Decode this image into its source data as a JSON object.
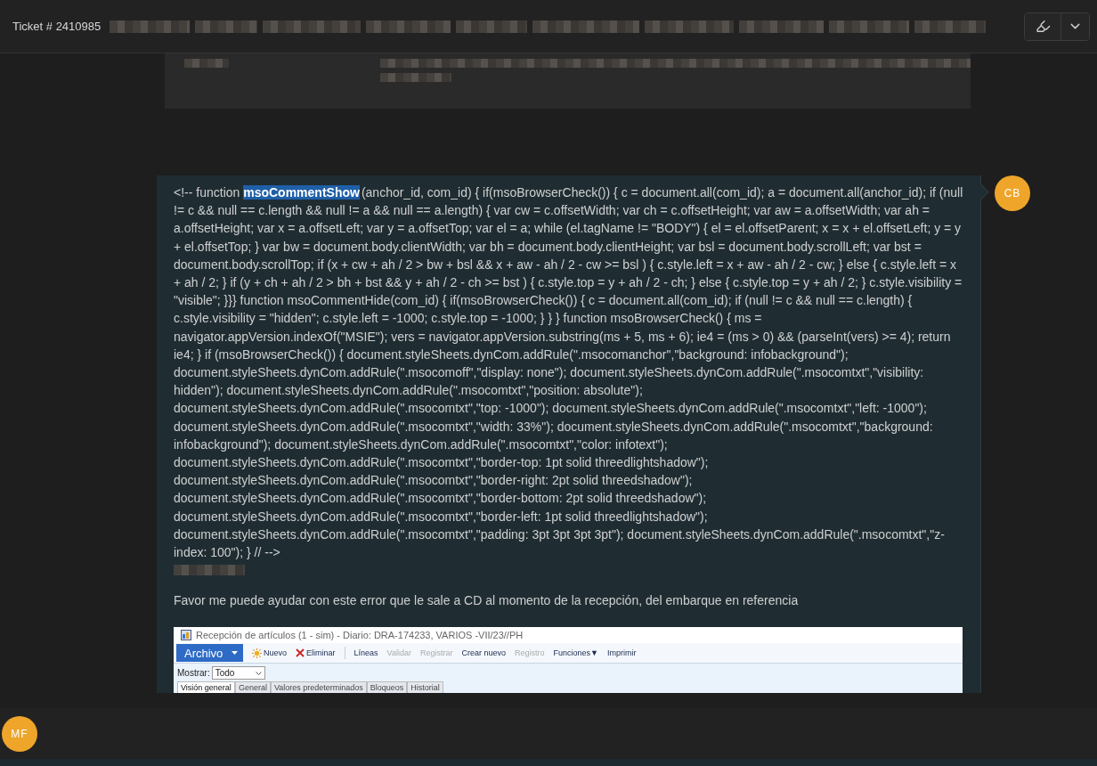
{
  "header": {
    "ticket": "Ticket # 2410985",
    "actions": [
      {
        "kind": "highlighter"
      },
      {
        "kind": "chevron"
      }
    ]
  },
  "message": {
    "avatar": "CB",
    "code": {
      "before": "<!-- function ",
      "highlighted": "msoCommentShow",
      "after": "(anchor_id, com_id) { if(msoBrowserCheck()) { c = document.all(com_id); a = document.all(anchor_id); if (null != c && null == c.length && null != a && null == a.length) { var cw = c.offsetWidth; var ch = c.offsetHeight; var aw = a.offsetWidth; var ah = a.offsetHeight; var x = a.offsetLeft; var y = a.offsetTop; var el = a; while (el.tagName != \"BODY\") { el = el.offsetParent; x = x + el.offsetLeft; y = y + el.offsetTop; } var bw = document.body.clientWidth; var bh = document.body.clientHeight; var bsl = document.body.scrollLeft; var bst = document.body.scrollTop; if (x + cw + ah / 2 > bw + bsl && x + aw - ah / 2 - cw >= bsl ) { c.style.left = x + aw - ah / 2 - cw; } else { c.style.left = x + ah / 2; } if (y + ch + ah / 2 > bh + bst && y + ah / 2 - ch >= bst ) { c.style.top = y + ah / 2 - ch; } else { c.style.top = y + ah / 2; } c.style.visibility = \"visible\"; }}} function msoCommentHide(com_id) { if(msoBrowserCheck()) { c = document.all(com_id); if (null != c && null == c.length) { c.style.visibility = \"hidden\"; c.style.left = -1000; c.style.top = -1000; } } } function msoBrowserCheck() { ms = navigator.appVersion.indexOf(\"MSIE\"); vers = navigator.appVersion.substring(ms + 5, ms + 6); ie4 = (ms > 0) && (parseInt(vers) >= 4); return ie4; } if (msoBrowserCheck()) { document.styleSheets.dynCom.addRule(\".msocomanchor\",\"background: infobackground\"); document.styleSheets.dynCom.addRule(\".msocomoff\",\"display: none\"); document.styleSheets.dynCom.addRule(\".msocomtxt\",\"visibility: hidden\"); document.styleSheets.dynCom.addRule(\".msocomtxt\",\"position: absolute\"); document.styleSheets.dynCom.addRule(\".msocomtxt\",\"top: -1000\"); document.styleSheets.dynCom.addRule(\".msocomtxt\",\"left: -1000\"); document.styleSheets.dynCom.addRule(\".msocomtxt\",\"width: 33%\"); document.styleSheets.dynCom.addRule(\".msocomtxt\",\"background: infobackground\"); document.styleSheets.dynCom.addRule(\".msocomtxt\",\"color: infotext\"); document.styleSheets.dynCom.addRule(\".msocomtxt\",\"border-top: 1pt solid threedlightshadow\"); document.styleSheets.dynCom.addRule(\".msocomtxt\",\"border-right: 2pt solid threedshadow\"); document.styleSheets.dynCom.addRule(\".msocomtxt\",\"border-bottom: 2pt solid threedshadow\"); document.styleSheets.dynCom.addRule(\".msocomtxt\",\"border-left: 1pt solid threedlightshadow\"); document.styleSheets.dynCom.addRule(\".msocomtxt\",\"padding: 3pt 3pt 3pt 3pt\"); document.styleSheets.dynCom.addRule(\".msocomtxt\",\"z-index: 100\"); } // -->"
    },
    "body": "Favor me puede ayudar con este error que le sale a CD al momento de la recepción, del embarque en referencia",
    "screenshot": {
      "title": "Recepción de artículos (1 - sim) - Diario: DRA-174233, VARIOS -VII/23//PH",
      "menu": "Archivo",
      "toolbar": [
        {
          "kind": "icon",
          "label": "Nuevo",
          "disabled": false
        },
        {
          "kind": "icon",
          "label": "Eliminar",
          "disabled": false
        },
        {
          "kind": "divider"
        },
        {
          "kind": "text",
          "label": "Líneas",
          "disabled": false
        },
        {
          "kind": "text",
          "label": "Validar",
          "disabled": true
        },
        {
          "kind": "text",
          "label": "Registrar",
          "disabled": true
        },
        {
          "kind": "text",
          "label": "Crear nuevo",
          "disabled": false
        },
        {
          "kind": "text",
          "label": "Registro",
          "disabled": true
        },
        {
          "kind": "text",
          "label": "Funciones▼",
          "disabled": false
        },
        {
          "kind": "text",
          "label": "Imprimir",
          "disabled": false
        }
      ],
      "filter": {
        "label": "Mostrar:",
        "value": "Todo"
      },
      "tabs": [
        {
          "label": "Visión general",
          "selected": true
        },
        {
          "label": "General",
          "selected": false
        },
        {
          "label": "Valores predeterminados",
          "selected": false
        },
        {
          "label": "Bloqueos",
          "selected": false
        },
        {
          "label": "Historial",
          "selected": false
        }
      ]
    }
  },
  "composer": {
    "avatar": "MF"
  }
}
